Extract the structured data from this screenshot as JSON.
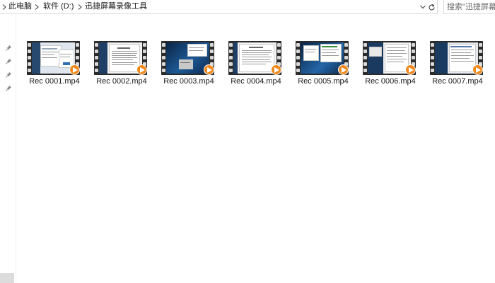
{
  "address_bar": {
    "crumbs": [
      "此电脑",
      "软件 (D:)",
      "迅捷屏幕录像工具"
    ]
  },
  "search": {
    "placeholder": "搜索\"迅捷屏幕录像工具\""
  },
  "icons": {
    "crumb_separator": "chevron-right-icon",
    "dropdown": "chevron-down-icon",
    "refresh": "refresh-icon",
    "pin": "pin-icon",
    "video_badge": "play-icon"
  },
  "files": [
    {
      "name": "Rec 0001.mp4"
    },
    {
      "name": "Rec 0002.mp4"
    },
    {
      "name": "Rec 0003.mp4"
    },
    {
      "name": "Rec 0004.mp4"
    },
    {
      "name": "Rec 0005.mp4"
    },
    {
      "name": "Rec 0006.mp4"
    },
    {
      "name": "Rec 0007.mp4"
    }
  ],
  "colors": {
    "badge": "#f08a1e",
    "film": "#2b2b2b"
  }
}
